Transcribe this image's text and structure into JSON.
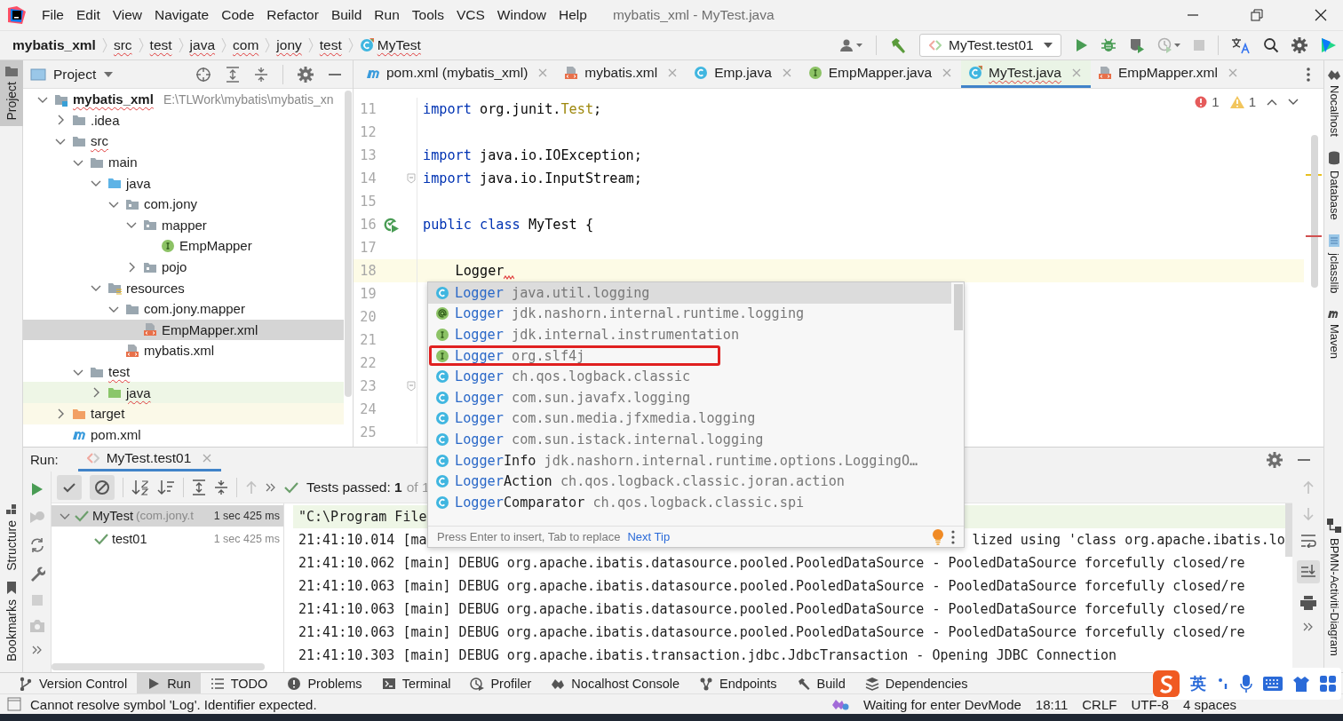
{
  "menu_bar": {
    "items": [
      "File",
      "Edit",
      "View",
      "Navigate",
      "Code",
      "Refactor",
      "Build",
      "Run",
      "Tools",
      "VCS",
      "Window",
      "Help"
    ],
    "title": "mybatis_xml - MyTest.java"
  },
  "breadcrumbs": [
    {
      "label": "mybatis_xml",
      "kind": "project",
      "underlined": false
    },
    {
      "label": "src",
      "kind": "folder",
      "underlined": true
    },
    {
      "label": "test",
      "kind": "folder",
      "underlined": true
    },
    {
      "label": "java",
      "kind": "folder",
      "underlined": true
    },
    {
      "label": "com",
      "kind": "folder",
      "underlined": true
    },
    {
      "label": "jony",
      "kind": "folder",
      "underlined": true
    },
    {
      "label": "test",
      "kind": "folder",
      "underlined": true
    },
    {
      "label": "MyTest",
      "kind": "test-class",
      "underlined": true
    }
  ],
  "run_config": {
    "label": "MyTest.test01"
  },
  "left_stripe": {
    "top": [
      {
        "label": "Project",
        "selected": true
      }
    ],
    "bottom": [
      {
        "label": "Structure",
        "selected": false
      },
      {
        "label": "Bookmarks",
        "selected": false
      }
    ]
  },
  "right_stripe": [
    {
      "label": "Nocalhost",
      "kind": "nocalhost"
    },
    {
      "label": "Database",
      "kind": "database"
    },
    {
      "label": "jclasslib",
      "kind": "jclasslib"
    },
    {
      "label": "Maven",
      "kind": "maven"
    },
    {
      "label": "BPMN-Activiti-Diagram",
      "kind": "bpmn"
    }
  ],
  "project_panel": {
    "title": "Project",
    "tree": [
      {
        "name": "mybatis_xml",
        "path": "E:\\TLWork\\mybatis\\mybatis_xn",
        "kind": "module",
        "expanded": true,
        "selected": false,
        "underlined": true,
        "children": [
          {
            "name": ".idea",
            "kind": "folder",
            "expanded": false,
            "selected": false,
            "underlined": false
          },
          {
            "name": "src",
            "kind": "folder",
            "expanded": true,
            "selected": false,
            "underlined": true,
            "children": [
              {
                "name": "main",
                "kind": "folder",
                "expanded": true,
                "selected": false,
                "underlined": false,
                "children": [
                  {
                    "name": "java",
                    "kind": "source",
                    "expanded": true,
                    "selected": false,
                    "underlined": false,
                    "children": [
                      {
                        "name": "com.jony",
                        "kind": "package",
                        "expanded": true,
                        "selected": false,
                        "underlined": false,
                        "children": [
                          {
                            "name": "mapper",
                            "kind": "package",
                            "expanded": true,
                            "selected": false,
                            "underlined": false,
                            "children": [
                              {
                                "name": "EmpMapper",
                                "kind": "interface",
                                "selected": false,
                                "underlined": false
                              }
                            ]
                          },
                          {
                            "name": "pojo",
                            "kind": "package",
                            "expanded": false,
                            "selected": false,
                            "underlined": false
                          }
                        ]
                      }
                    ]
                  },
                  {
                    "name": "resources",
                    "kind": "resources",
                    "expanded": true,
                    "selected": false,
                    "underlined": false,
                    "children": [
                      {
                        "name": "com.jony.mapper",
                        "kind": "folder",
                        "expanded": true,
                        "selected": false,
                        "underlined": false,
                        "children": [
                          {
                            "name": "EmpMapper.xml",
                            "kind": "xml",
                            "selected": true,
                            "underlined": false
                          }
                        ]
                      },
                      {
                        "name": "mybatis.xml",
                        "kind": "xml",
                        "selected": false,
                        "underlined": false
                      }
                    ]
                  }
                ]
              },
              {
                "name": "test",
                "kind": "folder",
                "expanded": true,
                "selected": false,
                "underlined": true,
                "children": [
                  {
                    "name": "java",
                    "kind": "test-source",
                    "expanded": false,
                    "selected": false,
                    "underlined": true
                  }
                ]
              }
            ]
          },
          {
            "name": "target",
            "kind": "excluded",
            "expanded": false,
            "selected": false,
            "underlined": false
          },
          {
            "name": "pom.xml",
            "kind": "maven",
            "selected": false,
            "underlined": false
          }
        ]
      }
    ]
  },
  "editor": {
    "tabs": [
      {
        "label": "pom.xml (mybatis_xml)",
        "kind": "maven",
        "selected": false,
        "underlined": false
      },
      {
        "label": "mybatis.xml",
        "kind": "xml",
        "selected": false,
        "underlined": false
      },
      {
        "label": "Emp.java",
        "kind": "class",
        "selected": false,
        "underlined": false
      },
      {
        "label": "EmpMapper.java",
        "kind": "interface",
        "selected": false,
        "underlined": false
      },
      {
        "label": "MyTest.java",
        "kind": "test-class",
        "selected": true,
        "underlined": true
      },
      {
        "label": "EmpMapper.xml",
        "kind": "xml",
        "selected": false,
        "underlined": false
      }
    ],
    "inspections": {
      "errors": "1",
      "warnings": "1"
    },
    "lines": [
      {
        "number": "11",
        "current": false,
        "error": false,
        "fold_marker": false,
        "run_marker": false,
        "tokens": [
          {
            "text": "import",
            "kind": "keyword"
          },
          {
            "text": " org.junit.",
            "kind": "plain"
          },
          {
            "text": "Test",
            "kind": "annotation"
          },
          {
            "text": ";",
            "kind": "plain"
          }
        ]
      },
      {
        "number": "12",
        "current": false,
        "error": false,
        "fold_marker": false,
        "run_marker": false
      },
      {
        "number": "13",
        "current": false,
        "error": false,
        "fold_marker": false,
        "run_marker": false,
        "tokens": [
          {
            "text": "import",
            "kind": "keyword"
          },
          {
            "text": " java.io.IOException;",
            "kind": "plain"
          }
        ]
      },
      {
        "number": "14",
        "current": false,
        "error": false,
        "fold_marker": true,
        "run_marker": false,
        "tokens": [
          {
            "text": "import",
            "kind": "keyword"
          },
          {
            "text": " java.io.InputStream;",
            "kind": "plain"
          }
        ]
      },
      {
        "number": "15",
        "current": false,
        "error": false,
        "fold_marker": false,
        "run_marker": false
      },
      {
        "number": "16",
        "current": false,
        "error": false,
        "fold_marker": false,
        "run_marker": true,
        "tokens": [
          {
            "text": "public class",
            "kind": "keyword"
          },
          {
            "text": " MyTest {",
            "kind": "plain"
          }
        ]
      },
      {
        "number": "17",
        "current": false,
        "error": false,
        "fold_marker": false,
        "run_marker": false
      },
      {
        "number": "18",
        "current": true,
        "error": true,
        "fold_marker": false,
        "run_marker": false,
        "tokens": [
          {
            "text": "    Logger",
            "kind": "plain"
          }
        ]
      },
      {
        "number": "19",
        "current": false,
        "error": false,
        "fold_marker": false,
        "run_marker": false
      },
      {
        "number": "20",
        "current": false,
        "error": false,
        "fold_marker": false,
        "run_marker": false
      },
      {
        "number": "21",
        "current": false,
        "error": false,
        "fold_marker": false,
        "run_marker": false
      },
      {
        "number": "22",
        "current": false,
        "error": false,
        "fold_marker": false,
        "run_marker": false
      },
      {
        "number": "23",
        "current": false,
        "error": false,
        "fold_marker": true,
        "run_marker": false
      },
      {
        "number": "24",
        "current": false,
        "error": false,
        "fold_marker": false,
        "run_marker": false
      },
      {
        "number": "25",
        "current": false,
        "error": false,
        "fold_marker": false,
        "run_marker": false
      }
    ],
    "completion": {
      "items": [
        {
          "kind": "class",
          "matched": "Logger",
          "package": "java.util.logging",
          "selected": true,
          "highlighted": false
        },
        {
          "kind": "annotation",
          "matched": "Logger",
          "package": "jdk.nashorn.internal.runtime.logging",
          "selected": false,
          "highlighted": false
        },
        {
          "kind": "interface",
          "matched": "Logger",
          "package": "jdk.internal.instrumentation",
          "selected": false,
          "highlighted": false
        },
        {
          "kind": "interface",
          "matched": "Logger",
          "package": "org.slf4j",
          "selected": false,
          "highlighted": true
        },
        {
          "kind": "class",
          "matched": "Logger",
          "package": "ch.qos.logback.classic",
          "selected": false,
          "highlighted": false
        },
        {
          "kind": "class",
          "matched": "Logger",
          "package": "com.sun.javafx.logging",
          "selected": false,
          "highlighted": false
        },
        {
          "kind": "class",
          "matched": "Logger",
          "package": "com.sun.media.jfxmedia.logging",
          "selected": false,
          "highlighted": false
        },
        {
          "kind": "class",
          "matched": "Logger",
          "package": "com.sun.istack.internal.logging",
          "selected": false,
          "highlighted": false
        },
        {
          "kind": "class",
          "matched": "Logger",
          "suffix": "Info",
          "package": "jdk.nashorn.internal.runtime.options.LoggingO…",
          "selected": false,
          "highlighted": false
        },
        {
          "kind": "class",
          "matched": "Logger",
          "suffix": "Action",
          "package": "ch.qos.logback.classic.joran.action",
          "selected": false,
          "highlighted": false
        },
        {
          "kind": "class",
          "matched": "Logger",
          "suffix": "Comparator",
          "package": "ch.qos.logback.classic.spi",
          "selected": false,
          "highlighted": false
        }
      ],
      "hint": "Press Enter to insert, Tab to replace",
      "hint_link": "Next Tip"
    }
  },
  "run_panel": {
    "label": "Run:",
    "tab": "MyTest.test01",
    "status": "Tests passed: **1**",
    "status_total": "of 1",
    "tests": [
      {
        "name": "MyTest",
        "detail": "(com.jony.t",
        "time": "1 sec 425 ms",
        "passed": true,
        "selected": true,
        "expanded": true,
        "children": [
          {
            "name": "test01",
            "time": "1 sec 425 ms",
            "passed": true,
            "selected": false
          }
        ]
      }
    ],
    "console": [
      {
        "command": true,
        "segments": [
          "\"C:\\Program File"
        ]
      },
      {
        "command": false,
        "segments": [
          "21:41:10.014 [ma",
          "lized using 'class org.apache.ibatis.lo"
        ]
      },
      {
        "command": false,
        "segments": [
          "21:41:10.062 [main] DEBUG org.apache.ibatis.datasource.pooled.PooledDataSource - PooledDataSource forcefully closed/re"
        ]
      },
      {
        "command": false,
        "segments": [
          "21:41:10.063 [main] DEBUG org.apache.ibatis.datasource.pooled.PooledDataSource - PooledDataSource forcefully closed/re"
        ]
      },
      {
        "command": false,
        "segments": [
          "21:41:10.063 [main] DEBUG org.apache.ibatis.datasource.pooled.PooledDataSource - PooledDataSource forcefully closed/re"
        ]
      },
      {
        "command": false,
        "segments": [
          "21:41:10.063 [main] DEBUG org.apache.ibatis.datasource.pooled.PooledDataSource - PooledDataSource forcefully closed/re"
        ]
      },
      {
        "command": false,
        "segments": [
          "21:41:10.303 [main] DEBUG org.apache.ibatis.transaction.jdbc.JdbcTransaction - Opening JDBC Connection"
        ]
      }
    ]
  },
  "tool_windows": [
    {
      "label": "Version Control",
      "kind": "vcs",
      "selected": false
    },
    {
      "label": "Run",
      "kind": "run",
      "selected": true
    },
    {
      "label": "TODO",
      "kind": "todo",
      "selected": false
    },
    {
      "label": "Problems",
      "kind": "problems",
      "selected": false
    },
    {
      "label": "Terminal",
      "kind": "terminal",
      "selected": false
    },
    {
      "label": "Profiler",
      "kind": "profiler",
      "selected": false
    },
    {
      "label": "Nocalhost Console",
      "kind": "nocalhost",
      "selected": false
    },
    {
      "label": "Endpoints",
      "kind": "endpoints",
      "selected": false
    },
    {
      "label": "Build",
      "kind": "build",
      "selected": false
    },
    {
      "label": "Dependencies",
      "kind": "dependencies",
      "selected": false
    }
  ],
  "status_bar": {
    "message": "Cannot resolve symbol 'Log'. Identifier expected.",
    "items": [
      "Waiting for enter DevMode",
      "18:11",
      "CRLF",
      "UTF-8",
      "4 spaces"
    ]
  },
  "ime_bar": {
    "language": "英"
  }
}
